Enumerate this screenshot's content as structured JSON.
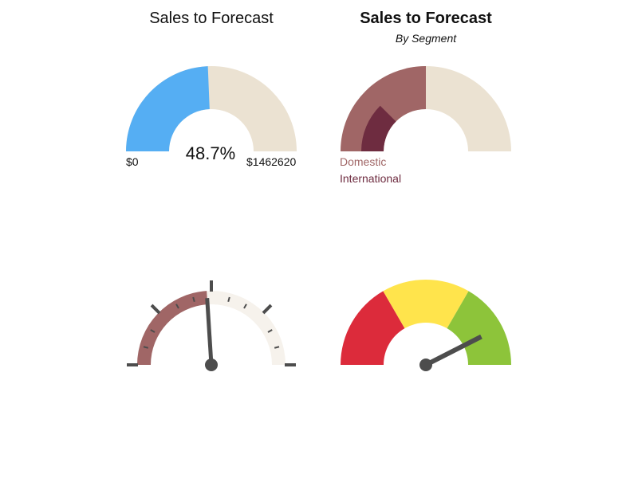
{
  "chart_data": [
    {
      "type": "gauge",
      "title": "Sales to Forecast",
      "value_fraction": 0.487,
      "value_label": "48.7%",
      "min_label": "$0",
      "max_label": "$1462620",
      "colors": {
        "fill": "#55aef3",
        "track": "#ebe2d2"
      }
    },
    {
      "type": "gauge",
      "title": "Sales to Forecast",
      "subtitle": "By Segment",
      "series": [
        {
          "name": "Domestic",
          "value_fraction": 0.5,
          "color": "#a06666"
        },
        {
          "name": "International",
          "value_fraction": 0.25,
          "color": "#6e2c40"
        }
      ],
      "colors": {
        "track": "#ebe2d2"
      }
    },
    {
      "type": "gauge",
      "style": "needle-with-ticks",
      "value_fraction": 0.48,
      "major_ticks": 5,
      "minor_ticks": 8,
      "colors": {
        "fill": "#a06666",
        "track": "#f6f2ec",
        "needle": "#4d4d4d",
        "ticks": "#4d4d4d"
      }
    },
    {
      "type": "gauge",
      "style": "banded-needle",
      "value_fraction": 0.85,
      "bands": [
        {
          "from": 0.0,
          "to": 0.333,
          "color": "#dc2b3b"
        },
        {
          "from": 0.333,
          "to": 0.667,
          "color": "#ffe44c"
        },
        {
          "from": 0.667,
          "to": 1.0,
          "color": "#8dc43a"
        }
      ],
      "colors": {
        "needle": "#4d4d4d"
      }
    }
  ]
}
